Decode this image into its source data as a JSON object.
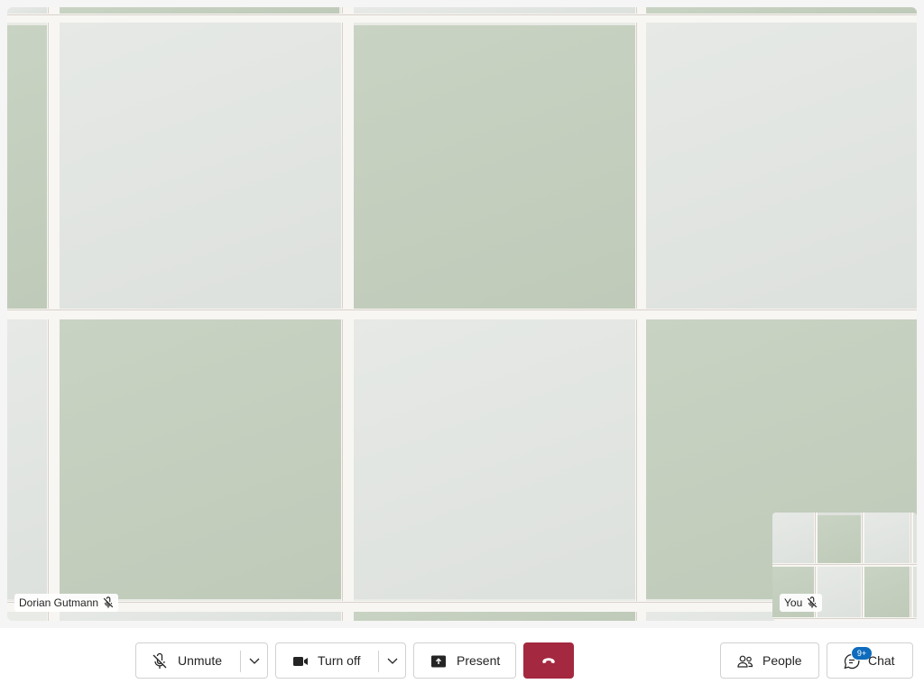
{
  "main_video": {
    "participant_name": "Dorian Gutmann",
    "muted_icon": "mic-off-icon"
  },
  "self_view": {
    "label": "You",
    "muted_icon": "mic-off-icon"
  },
  "controls": {
    "unmute_label": "Unmute",
    "camera_label": "Turn off",
    "present_label": "Present",
    "hangup_icon": "phone-hangup-icon",
    "people_label": "People",
    "chat_label": "Chat",
    "chat_badge": "9+"
  },
  "colors": {
    "hangup": "#a4283f",
    "badge": "#0f6cbd"
  }
}
